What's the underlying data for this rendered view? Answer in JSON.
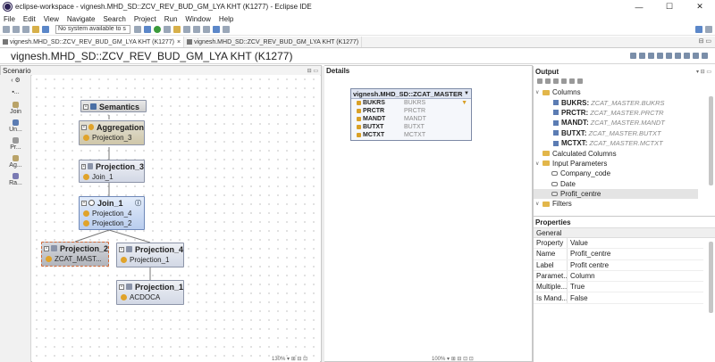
{
  "window": {
    "title": "eclipse-workspace - vignesh.MHD_SD::ZCV_REV_BUD_GM_LYA KHT (K1277) - Eclipse IDE",
    "controls": [
      "—",
      "☐",
      "✕"
    ]
  },
  "menu": [
    "File",
    "Edit",
    "View",
    "Navigate",
    "Search",
    "Project",
    "Run",
    "Window",
    "Help"
  ],
  "toolbar": {
    "system_box": "No system available to s"
  },
  "tabs": [
    {
      "label": "vignesh.MHD_SD::ZCV_REV_BUD_GM_LYA KHT (K1277)",
      "active": true
    },
    {
      "label": "vignesh.MHD_SD::ZCV_REV_BUD_GM_LYA KHT (K1277)",
      "active": false
    }
  ],
  "editor_title": "vignesh.MHD_SD::ZCV_REV_BUD_GM_LYA KHT (K1277)",
  "scenario": {
    "label": "Scenario",
    "palette": [
      "Join",
      "Un...",
      "Pr...",
      "Ag...",
      "Ra..."
    ],
    "nodes": {
      "semantics": "Semantics",
      "aggregation": {
        "title": "Aggregation",
        "row": "Projection_3"
      },
      "projection3": {
        "title": "Projection_3",
        "row": "Join_1"
      },
      "join1": {
        "title": "Join_1",
        "rows": [
          "Projection_4",
          "Projection_2"
        ]
      },
      "projection2": {
        "title": "Projection_2",
        "row": "ZCAT_MAST..."
      },
      "projection4": {
        "title": "Projection_4",
        "row": "Projection_1"
      },
      "projection1": {
        "title": "Projection_1",
        "row": "ACDOCA"
      }
    },
    "status": "130%"
  },
  "details": {
    "label": "Details",
    "table_title": "vignesh.MHD_SD::ZCAT_MASTER",
    "rows": [
      {
        "name": "BUKRS",
        "source": "BUKRS"
      },
      {
        "name": "PRCTR",
        "source": "PRCTR"
      },
      {
        "name": "MANDT",
        "source": "MANDT"
      },
      {
        "name": "BUTXT",
        "source": "BUTXT"
      },
      {
        "name": "MCTXT",
        "source": "MCTXT"
      }
    ],
    "status": "100%"
  },
  "output": {
    "label": "Output",
    "columns_label": "Columns",
    "columns": [
      {
        "name": "BUKRS:",
        "mapping": "ZCAT_MASTER.BUKRS"
      },
      {
        "name": "PRCTR:",
        "mapping": "ZCAT_MASTER.PRCTR"
      },
      {
        "name": "MANDT:",
        "mapping": "ZCAT_MASTER.MANDT"
      },
      {
        "name": "BUTXT:",
        "mapping": "ZCAT_MASTER.BUTXT"
      },
      {
        "name": "MCTXT:",
        "mapping": "ZCAT_MASTER.MCTXT"
      }
    ],
    "calculated_columns": "Calculated Columns",
    "input_parameters": "Input Parameters",
    "parameters": [
      "Company_code",
      "Date",
      "Profit_centre"
    ],
    "filters": "Filters"
  },
  "properties": {
    "label": "Properties",
    "section": "General",
    "rows": [
      {
        "key": "Property",
        "value": "Value"
      },
      {
        "key": "Name",
        "value": "Profit_centre"
      },
      {
        "key": "Label",
        "value": "Profit centre"
      },
      {
        "key": "Paramet...",
        "value": "Column"
      },
      {
        "key": "Multiple...",
        "value": "True"
      },
      {
        "key": "Is Mand...",
        "value": "False"
      }
    ]
  }
}
